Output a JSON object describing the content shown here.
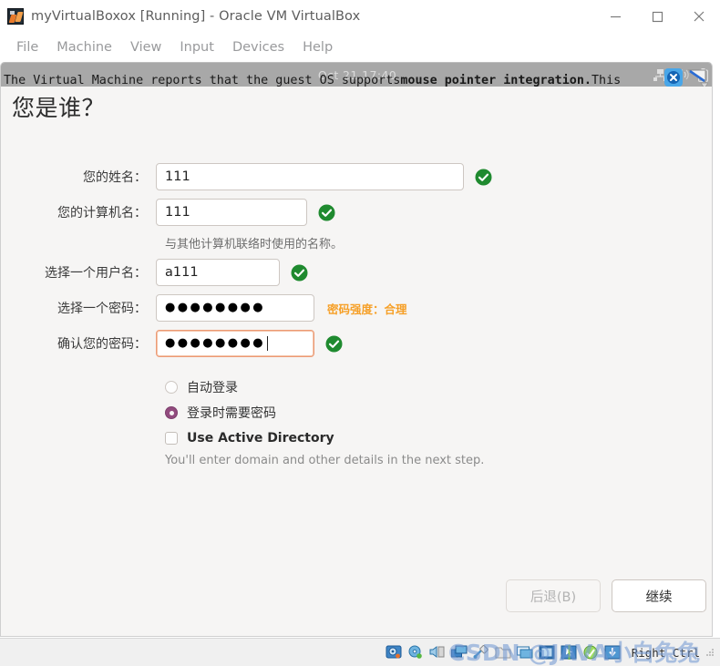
{
  "window": {
    "title": "myVirtualBoxox [Running] - Oracle VM VirtualBox",
    "logo_icon": "virtualbox-logo-icon",
    "controls": [
      {
        "name": "minimize",
        "icon": "minimize-icon"
      },
      {
        "name": "maximize",
        "icon": "maximize-icon"
      },
      {
        "name": "close",
        "icon": "close-icon"
      }
    ]
  },
  "menubar": {
    "items": [
      {
        "label": "File"
      },
      {
        "label": "Machine"
      },
      {
        "label": "View"
      },
      {
        "label": "Input"
      },
      {
        "label": "Devices"
      },
      {
        "label": "Help"
      }
    ]
  },
  "guest_panel": {
    "clock": "Oct 21 17:40",
    "tray_icons": [
      "network-icon",
      "volume-icon",
      "battery-icon"
    ]
  },
  "vm_message": {
    "text_before": "The Virtual Machine reports that the guest OS supports ",
    "text_bold": "mouse pointer integration.",
    "text_after": " This",
    "close_icon": "close-circle-icon",
    "collapse_icon": "collapse-arrow-icon"
  },
  "installer": {
    "title": "您是谁？",
    "fields": [
      {
        "label": "您的姓名：",
        "value": "111",
        "width": "w-long",
        "valid_icon": "check-circle-icon",
        "valid": true,
        "focused": false,
        "masked": false
      },
      {
        "label": "您的计算机名：",
        "value": "111",
        "width": "w-mid",
        "valid_icon": "check-circle-icon",
        "valid": true,
        "focused": false,
        "masked": false,
        "hint": "与其他计算机联络时使用的名称。"
      },
      {
        "label": "选择一个用户名：",
        "value": "a111",
        "width": "w-user",
        "valid_icon": "check-circle-icon",
        "valid": true,
        "focused": false,
        "masked": false
      },
      {
        "label": "选择一个密码：",
        "value": "●●●●●●●●",
        "width": "w-pass",
        "valid": false,
        "focused": false,
        "masked": true,
        "strength": "密码强度：合理"
      },
      {
        "label": "确认您的密码：",
        "value": "●●●●●●●●",
        "width": "w-pass",
        "valid_icon": "check-circle-icon",
        "valid": true,
        "focused": true,
        "masked": true
      }
    ],
    "options": {
      "auto_login": {
        "label": "自动登录",
        "selected": false
      },
      "require_password": {
        "label": "登录时需要密码",
        "selected": true
      },
      "active_directory": {
        "label": "Use Active Directory",
        "checked": false
      },
      "active_directory_hint": "You'll enter domain and other details in the next step."
    },
    "buttons": {
      "back": {
        "label": "后退(B)",
        "disabled": true
      },
      "continue": {
        "label": "继续",
        "disabled": false
      }
    }
  },
  "statusbar": {
    "icons": [
      "hard-disk-icon",
      "optical-disk-icon",
      "audio-icon",
      "network-adapter-icon",
      "usb-icon",
      "shared-folder-icon",
      "display-icon",
      "recording-icon",
      "mouse-integration-icon",
      "keyboard-icon",
      "host-key-icon"
    ],
    "host_key": "Right Ctrl"
  },
  "watermark": {
    "text": "CSDN @JAVA小白兔兔"
  },
  "colors": {
    "accent_purple": "#924b7e",
    "valid_green": "#1f8a2f",
    "strength_orange": "#f6a028",
    "focus_border": "#ec9a75",
    "guest_bg": "#f6f5f4",
    "panel_gray": "#a8a8a8"
  }
}
